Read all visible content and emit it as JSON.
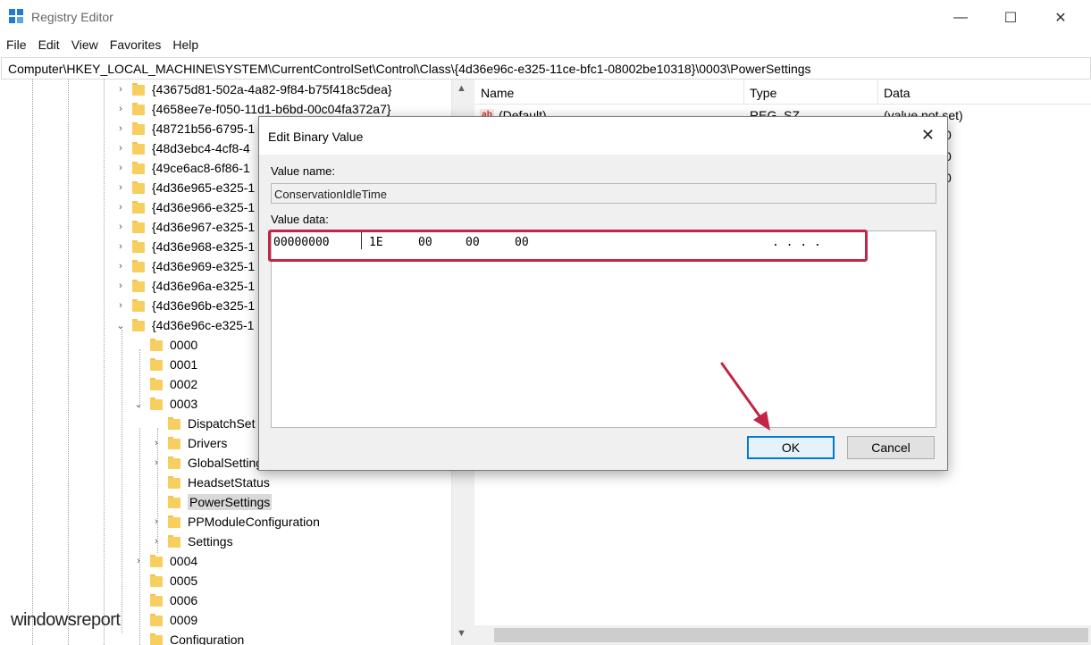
{
  "window": {
    "title": "Registry Editor",
    "minimize": "—",
    "maximize": "☐",
    "close": "✕"
  },
  "menu": [
    "File",
    "Edit",
    "View",
    "Favorites",
    "Help"
  ],
  "address": "Computer\\HKEY_LOCAL_MACHINE\\SYSTEM\\CurrentControlSet\\Control\\Class\\{4d36e96c-e325-11ce-bfc1-08002be10318}\\0003\\PowerSettings",
  "tree": [
    {
      "label": "{43675d81-502a-4a82-9f84-b75f418c5dea}",
      "chevron": "›"
    },
    {
      "label": "{4658ee7e-f050-11d1-b6bd-00c04fa372a7}",
      "chevron": "›"
    },
    {
      "label": "{48721b56-6795-1",
      "chevron": "›"
    },
    {
      "label": "{48d3ebc4-4cf8-4",
      "chevron": "›"
    },
    {
      "label": "{49ce6ac8-6f86-1",
      "chevron": "›"
    },
    {
      "label": "{4d36e965-e325-1",
      "chevron": "›"
    },
    {
      "label": "{4d36e966-e325-1",
      "chevron": "›"
    },
    {
      "label": "{4d36e967-e325-1",
      "chevron": "›"
    },
    {
      "label": "{4d36e968-e325-1",
      "chevron": "›"
    },
    {
      "label": "{4d36e969-e325-1",
      "chevron": "›"
    },
    {
      "label": "{4d36e96a-e325-1",
      "chevron": "›"
    },
    {
      "label": "{4d36e96b-e325-1",
      "chevron": "›"
    },
    {
      "label": "{4d36e96c-e325-1",
      "chevron": "⌄"
    },
    {
      "label": "0000",
      "chevron": ""
    },
    {
      "label": "0001",
      "chevron": ""
    },
    {
      "label": "0002",
      "chevron": ""
    },
    {
      "label": "0003",
      "chevron": "⌄"
    },
    {
      "label": "DispatchSet",
      "chevron": ""
    },
    {
      "label": "Drivers",
      "chevron": "›"
    },
    {
      "label": "GlobalSetting",
      "chevron": "›"
    },
    {
      "label": "HeadsetStatus",
      "chevron": ""
    },
    {
      "label": "PowerSettings",
      "chevron": ""
    },
    {
      "label": "PPModuleConfiguration",
      "chevron": "›"
    },
    {
      "label": "Settings",
      "chevron": "›"
    },
    {
      "label": "0004",
      "chevron": "›"
    },
    {
      "label": "0005",
      "chevron": ""
    },
    {
      "label": "0006",
      "chevron": ""
    },
    {
      "label": "0009",
      "chevron": ""
    },
    {
      "label": "Configuration",
      "chevron": ""
    }
  ],
  "list": {
    "headers": [
      "Name",
      "Type",
      "Data"
    ],
    "rows": [
      {
        "name": "(Default)",
        "type": "REG_SZ",
        "data": "(value not set)"
      }
    ],
    "partial_data": [
      "0",
      "0",
      "0"
    ]
  },
  "dialog": {
    "title": "Edit Binary Value",
    "close": "✕",
    "value_name_label": "Value name:",
    "value_name": "ConservationIdleTime",
    "value_data_label": "Value data:",
    "hex": {
      "offset": "00000000",
      "bytes": [
        "1E",
        "00",
        "00",
        "00"
      ],
      "ascii": ". . . ."
    },
    "ok": "OK",
    "cancel": "Cancel"
  },
  "watermark": {
    "brand": "windows",
    "suffix": "report"
  },
  "colors": {
    "highlight_rect": "#c22545",
    "arrow": "#c22545",
    "default_button_border": "#0078d7"
  }
}
